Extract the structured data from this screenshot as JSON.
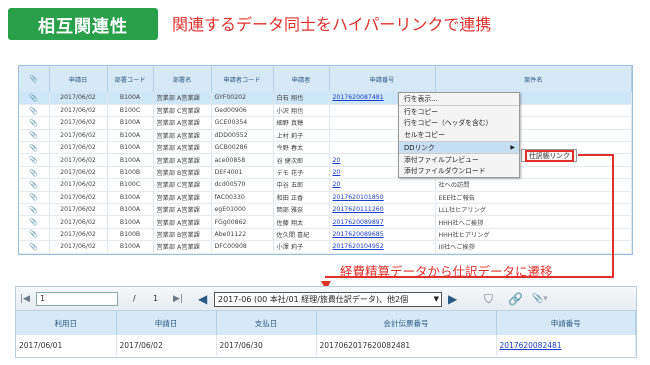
{
  "badge": "相互関連性",
  "headline": "関連するデータ同士をハイパーリンクで連携",
  "callout": "経費精算データから仕訳データに遷移",
  "top_grid": {
    "columns": [
      "",
      "申請日",
      "部署コード",
      "部署名",
      "申請者コード",
      "申請者",
      "申請番号",
      "案件名"
    ],
    "rows": [
      {
        "date": "2017/06/02",
        "dept_code": "B100A",
        "dept": "営業部 A営業課",
        "app_code": "GYF00202",
        "applicant": "白石 翔也",
        "number": "2017620087481",
        "title": "DDD社ご報告",
        "selected": true
      },
      {
        "date": "2017/06/02",
        "dept_code": "B100C",
        "dept": "営業部 C営業課",
        "app_code": "Ged00906",
        "applicant": "小沢 翔也",
        "number": "",
        "title": "社訪問"
      },
      {
        "date": "2017/06/02",
        "dept_code": "B100A",
        "dept": "営業部 A営業課",
        "app_code": "GCE00354",
        "applicant": "細野 真穂",
        "number": "",
        "title": "社訪問"
      },
      {
        "date": "2017/06/02",
        "dept_code": "B100A",
        "dept": "営業部 A営業課",
        "app_code": "dDD00552",
        "applicant": "上村 莉子",
        "number": "",
        "title": "社でのお打合せ"
      },
      {
        "date": "2017/06/02",
        "dept_code": "B100A",
        "dept": "営業部 A営業課",
        "app_code": "GCB00286",
        "applicant": "今野 春太",
        "number": "",
        "title": "社と合同イベント"
      },
      {
        "date": "2017/06/02",
        "dept_code": "B100A",
        "dept": "営業部 A営業課",
        "app_code": "ace00858",
        "applicant": "谷 健次郎",
        "number": "20",
        "title": ""
      },
      {
        "date": "2017/06/02",
        "dept_code": "B100B",
        "dept": "営業部 B営業課",
        "app_code": "DEF4001",
        "applicant": "デモ 花子",
        "number": "20",
        "title": "社種類事項のお問い"
      },
      {
        "date": "2017/06/02",
        "dept_code": "B100C",
        "dept": "営業部 C営業課",
        "app_code": "dcd00570",
        "applicant": "中谷 五郎",
        "number": "20",
        "title": "社への訪問"
      },
      {
        "date": "2017/06/02",
        "dept_code": "B100A",
        "dept": "営業部 A営業課",
        "app_code": "fAC00330",
        "applicant": "和田 正香",
        "number": "2017620101850",
        "title": "EEE社ご報告"
      },
      {
        "date": "2017/06/02",
        "dept_code": "B100A",
        "dept": "営業部 A営業課",
        "app_code": "egE01000",
        "applicant": "岡部 雅奈",
        "number": "2017620111260",
        "title": "LLL社ヒアリング"
      },
      {
        "date": "2017/06/02",
        "dept_code": "B100A",
        "dept": "営業部 A営業課",
        "app_code": "FGg00862",
        "applicant": "佐藤 翔太",
        "number": "2017620089897",
        "title": "HHH社へご挨拶"
      },
      {
        "date": "2017/06/02",
        "dept_code": "B100B",
        "dept": "営業部 B営業課",
        "app_code": "Abe01122",
        "applicant": "佐久間 喜紀",
        "number": "2017620089685",
        "title": "HHH社ヒアリング"
      },
      {
        "date": "2017/06/02",
        "dept_code": "B100A",
        "dept": "営業部 A営業課",
        "app_code": "DFC00908",
        "applicant": "小澤 莉子",
        "number": "2017620104952",
        "title": "III社へご挨拶"
      }
    ]
  },
  "context_menu": {
    "items": [
      {
        "label": "行を表示..."
      },
      {
        "label": "行をコピー",
        "sep": true
      },
      {
        "label": "行をコピー（ヘッダを含む）"
      },
      {
        "label": "セルをコピー"
      },
      {
        "label": "DDリンク",
        "sep": true,
        "highlight": true,
        "arrow": "▶"
      },
      {
        "label": "添付ファイルプレビュー",
        "sep": true
      },
      {
        "label": "添付ファイルダウンロード"
      }
    ],
    "submenu": "仕訳帳リンク"
  },
  "bottom_panel": {
    "page_value": "1",
    "page_sep": "/",
    "page_total": "1",
    "combo_value": "2017-06 (00 本社/01 経理/旅費仕訳データ)、他2個",
    "columns": [
      "利用日",
      "申請日",
      "支払日",
      "会計伝票番号",
      "申請番号"
    ],
    "row": {
      "use_date": "2017/06/01",
      "app_date": "2017/06/02",
      "pay_date": "2017/06/30",
      "voucher": "2017062017620082481",
      "app_number": "2017620082481"
    }
  }
}
